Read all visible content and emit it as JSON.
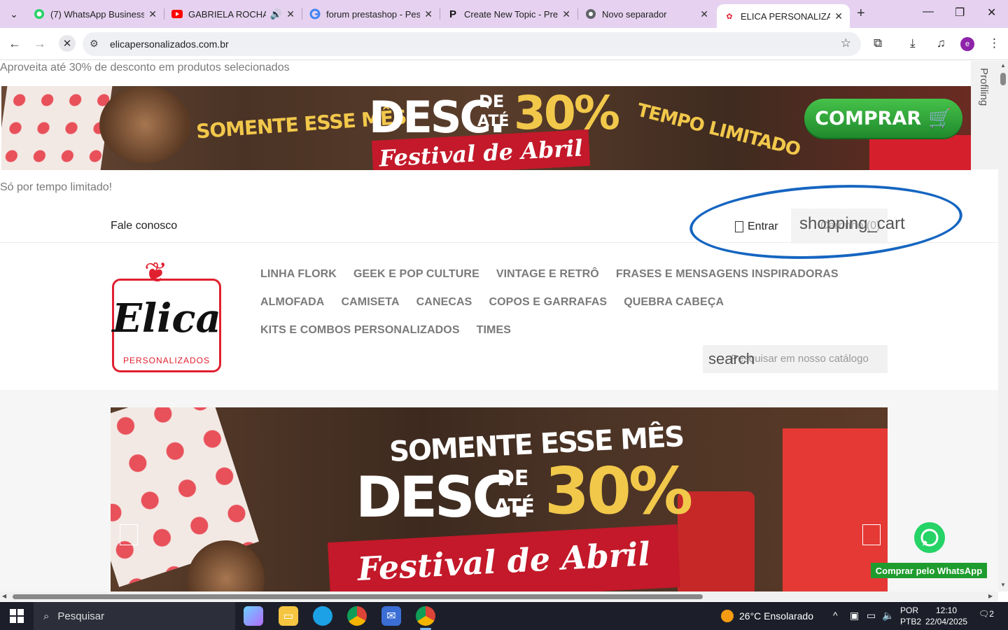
{
  "browser": {
    "tabs": [
      {
        "title": "(7) WhatsApp Business",
        "favicon": "whatsapp-icon",
        "color": "#25d366"
      },
      {
        "title": "GABRIELA ROCHA -",
        "favicon": "youtube-icon",
        "color": "#ff0000",
        "audio": true
      },
      {
        "title": "forum prestashop - Pesq",
        "favicon": "google-icon",
        "color": "#4285f4"
      },
      {
        "title": "Create New Topic - Pres",
        "favicon": "prestashop-p-icon",
        "color": "#111111"
      },
      {
        "title": "Novo separador",
        "favicon": "chrome-icon",
        "color": "#5f6368"
      },
      {
        "title": "ELICA PERSONALIZADO",
        "favicon": "elica-icon",
        "color": "#e0202f"
      }
    ],
    "url": "elicapersonalizados.com.br",
    "profile_initial": "e"
  },
  "page": {
    "promo_text": "Aproveita até 30% de desconto em produtos selecionados",
    "banner": {
      "somente": "SOMENTE ESSE MÊS",
      "desc": "DESC.",
      "de": "DE",
      "ate": "ATÉ",
      "percent": "30%",
      "festival": "Festival de Abril",
      "tempo": "TEMPO LIMITADO",
      "comprar": "COMPRAR"
    },
    "profiling_label": "Profiling",
    "tempo_text": "Só por tempo limitado!",
    "header": {
      "contact": "Fale conosco",
      "login": "Entrar",
      "cart_icon_text": "shopping_cart",
      "cart_label": "Carrinho",
      "cart_count": "(0)"
    },
    "logo": {
      "name": "Elica",
      "sub": "PERSONALIZADOS"
    },
    "menu": {
      "row1": [
        "LINHA FLORK",
        "GEEK E POP CULTURE",
        "VINTAGE E RETRÔ",
        "FRASES E MENSAGENS INSPIRADORAS"
      ],
      "row2": [
        "ALMOFADA",
        "CAMISETA",
        "CANECAS",
        "COPOS E GARRAFAS",
        "QUEBRA CABEÇA"
      ],
      "row3": [
        "KITS E COMBOS PERSONALIZADOS",
        "TIMES"
      ]
    },
    "search": {
      "icon_text": "search",
      "placeholder": "Pesquisar em nosso catálogo"
    },
    "slider": {
      "somente": "SOMENTE ESSE MÊS",
      "desc": "DESC.",
      "de": "DE",
      "ate": "ATÉ",
      "percent": "30%",
      "festival": "Festival de Abril"
    },
    "whatsapp_label": "Comprar pelo WhatsApp",
    "annotation_color": "#1565c0"
  },
  "taskbar": {
    "search_label": "Pesquisar",
    "weather": "26°C  Ensolarado",
    "lang_line1": "POR",
    "lang_line2": "PTB2",
    "time": "12:10",
    "date": "22/04/2025",
    "notifications": "2"
  }
}
